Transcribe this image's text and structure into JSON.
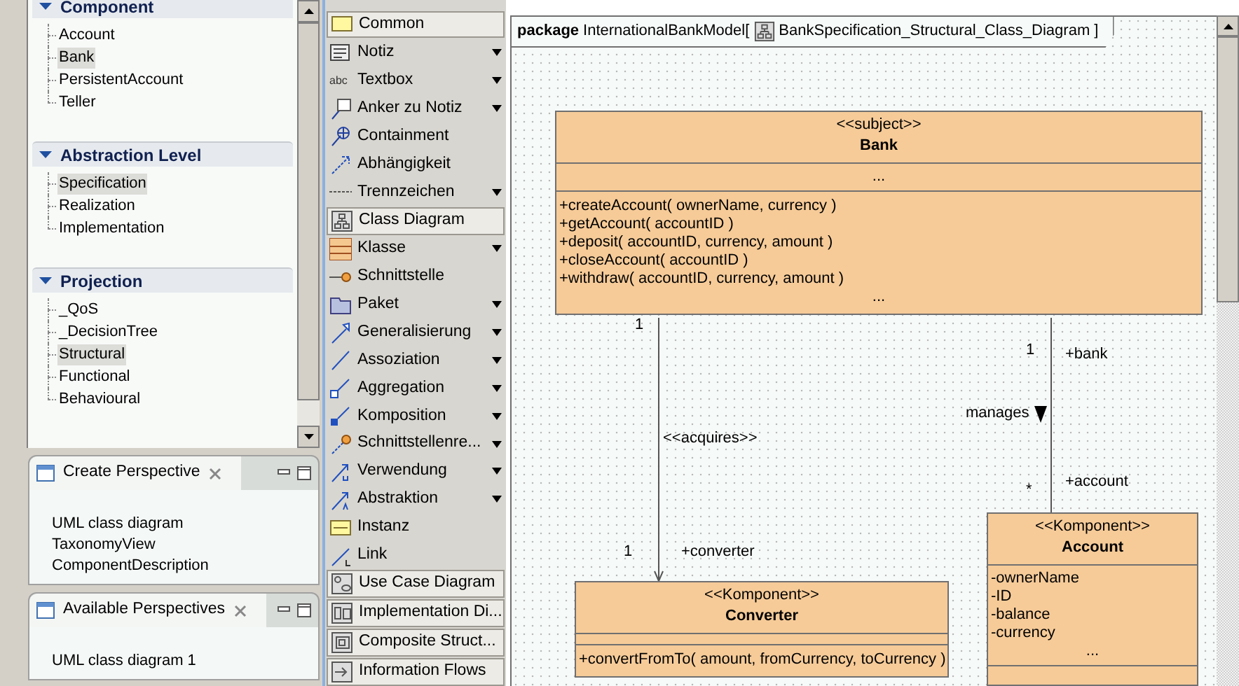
{
  "navigator": {
    "sections": [
      {
        "title": "Component",
        "expanded": true,
        "items": [
          {
            "label": "Account",
            "selected": false
          },
          {
            "label": "Bank",
            "selected": true
          },
          {
            "label": "PersistentAccount",
            "selected": false
          },
          {
            "label": "Teller",
            "selected": false
          }
        ]
      },
      {
        "title": "Abstraction Level",
        "expanded": true,
        "items": [
          {
            "label": "Specification",
            "selected": true
          },
          {
            "label": "Realization",
            "selected": false
          },
          {
            "label": "Implementation",
            "selected": false
          }
        ]
      },
      {
        "title": "Projection",
        "expanded": true,
        "items": [
          {
            "label": "_QoS",
            "selected": false
          },
          {
            "label": "_DecisionTree",
            "selected": false
          },
          {
            "label": "Structural",
            "selected": true
          },
          {
            "label": "Functional",
            "selected": false
          },
          {
            "label": "Behavioural",
            "selected": false
          }
        ]
      }
    ]
  },
  "views": [
    {
      "title": "Create Perspective",
      "items": [
        "UML class diagram",
        "TaxonomyView",
        "ComponentDescription"
      ]
    },
    {
      "title": "Available Perspectives",
      "items": [
        "UML class diagram 1"
      ]
    }
  ],
  "palette": [
    {
      "kind": "drawer",
      "label": "Common"
    },
    {
      "kind": "tool",
      "label": "Notiz",
      "has_menu": true
    },
    {
      "kind": "tool",
      "label": "Textbox",
      "has_menu": true,
      "icon_text": "abc"
    },
    {
      "kind": "tool",
      "label": "Anker zu Notiz",
      "has_menu": true
    },
    {
      "kind": "tool",
      "label": "Containment",
      "has_menu": false
    },
    {
      "kind": "tool",
      "label": "Abhängigkeit",
      "has_menu": false
    },
    {
      "kind": "tool",
      "label": "Trennzeichen",
      "has_menu": true
    },
    {
      "kind": "drawer",
      "label": "Class Diagram"
    },
    {
      "kind": "tool",
      "label": "Klasse",
      "has_menu": true
    },
    {
      "kind": "tool",
      "label": "Schnittstelle",
      "has_menu": false
    },
    {
      "kind": "tool",
      "label": "Paket",
      "has_menu": true
    },
    {
      "kind": "tool",
      "label": "Generalisierung",
      "has_menu": true
    },
    {
      "kind": "tool",
      "label": "Assoziation",
      "has_menu": true
    },
    {
      "kind": "tool",
      "label": "Aggregation",
      "has_menu": true
    },
    {
      "kind": "tool",
      "label": "Komposition",
      "has_menu": true
    },
    {
      "kind": "tool",
      "label": "Schnittstellenre...",
      "has_menu": true
    },
    {
      "kind": "tool",
      "label": "Verwendung",
      "has_menu": true
    },
    {
      "kind": "tool",
      "label": "Abstraktion",
      "has_menu": true
    },
    {
      "kind": "tool",
      "label": "Instanz",
      "has_menu": false
    },
    {
      "kind": "tool",
      "label": "Link",
      "has_menu": false
    },
    {
      "kind": "drawer",
      "label": "Use Case Diagram"
    },
    {
      "kind": "drawer",
      "label": "Implementation Di..."
    },
    {
      "kind": "drawer",
      "label": "Composite Struct..."
    },
    {
      "kind": "drawer",
      "label": "Information Flows"
    }
  ],
  "diagram": {
    "frame_keyword": "package",
    "frame_name": "InternationalBankModel[",
    "diagram_name": "BankSpecification_Structural_Class_Diagram ]",
    "classes": [
      {
        "stereotype": "<<subject>>",
        "name": "Bank",
        "attributes": [
          "..."
        ],
        "operations": [
          "+createAccount( ownerName, currency )",
          "+getAccount( accountID )",
          "+deposit( accountID, currency, amount )",
          "+closeAccount( accountID )",
          "+withdraw( accountID, currency, amount )",
          "..."
        ]
      },
      {
        "stereotype": "<<Komponent>>",
        "name": "Converter",
        "operations": [
          "+convertFromTo( amount, fromCurrency, toCurrency )"
        ]
      },
      {
        "stereotype": "<<Komponent>>",
        "name": "Account",
        "attributes": [
          "-ownerName",
          "-ID",
          "-balance",
          "-currency",
          "..."
        ]
      }
    ],
    "relations": [
      {
        "kind": "dependency",
        "label": "<<acquires>>",
        "source_multiplicity": "1",
        "target_multiplicity": "1",
        "target_role": "+converter"
      },
      {
        "kind": "association",
        "label": "manages",
        "source_multiplicity": "1",
        "source_role": "+bank",
        "target_multiplicity": "*",
        "target_role": "+account"
      }
    ]
  }
}
